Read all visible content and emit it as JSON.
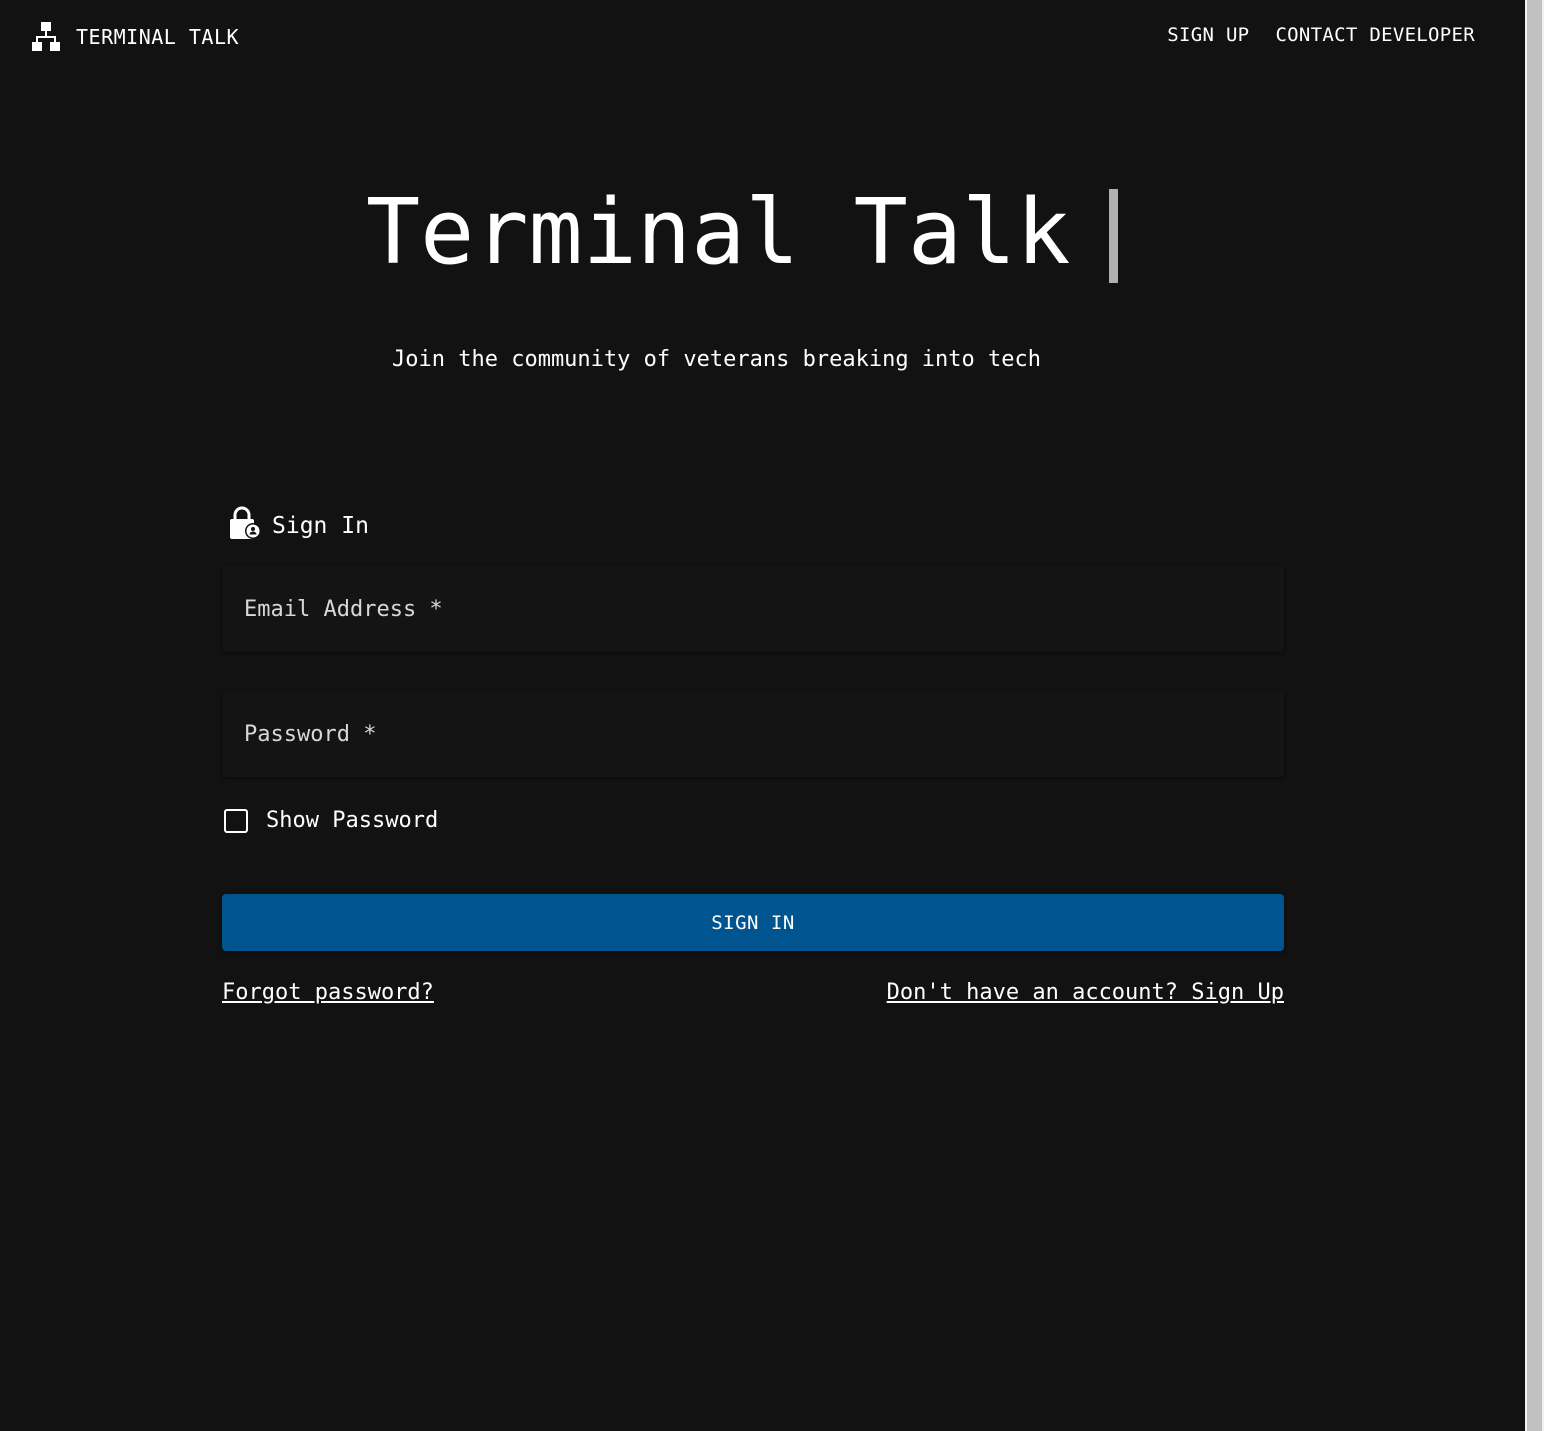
{
  "header": {
    "brand_icon": "sitemap-icon",
    "brand": "TERMINAL TALK",
    "nav": [
      "SIGN UP",
      "CONTACT DEVELOPER"
    ]
  },
  "hero": {
    "title": "Terminal Talk",
    "subtitle": "Join the community of veterans breaking into tech"
  },
  "form": {
    "heading_icon": "lock-person-icon",
    "heading": "Sign In",
    "email_placeholder": "Email Address *",
    "password_placeholder": "Password *",
    "show_password_label": "Show Password",
    "show_password_checked": false,
    "submit_label": "SIGN IN",
    "forgot_link": "Forgot password?",
    "signup_link": "Don't have an account? Sign Up"
  },
  "colors": {
    "background": "#121212",
    "button": "#00548f",
    "text": "#ffffff"
  }
}
